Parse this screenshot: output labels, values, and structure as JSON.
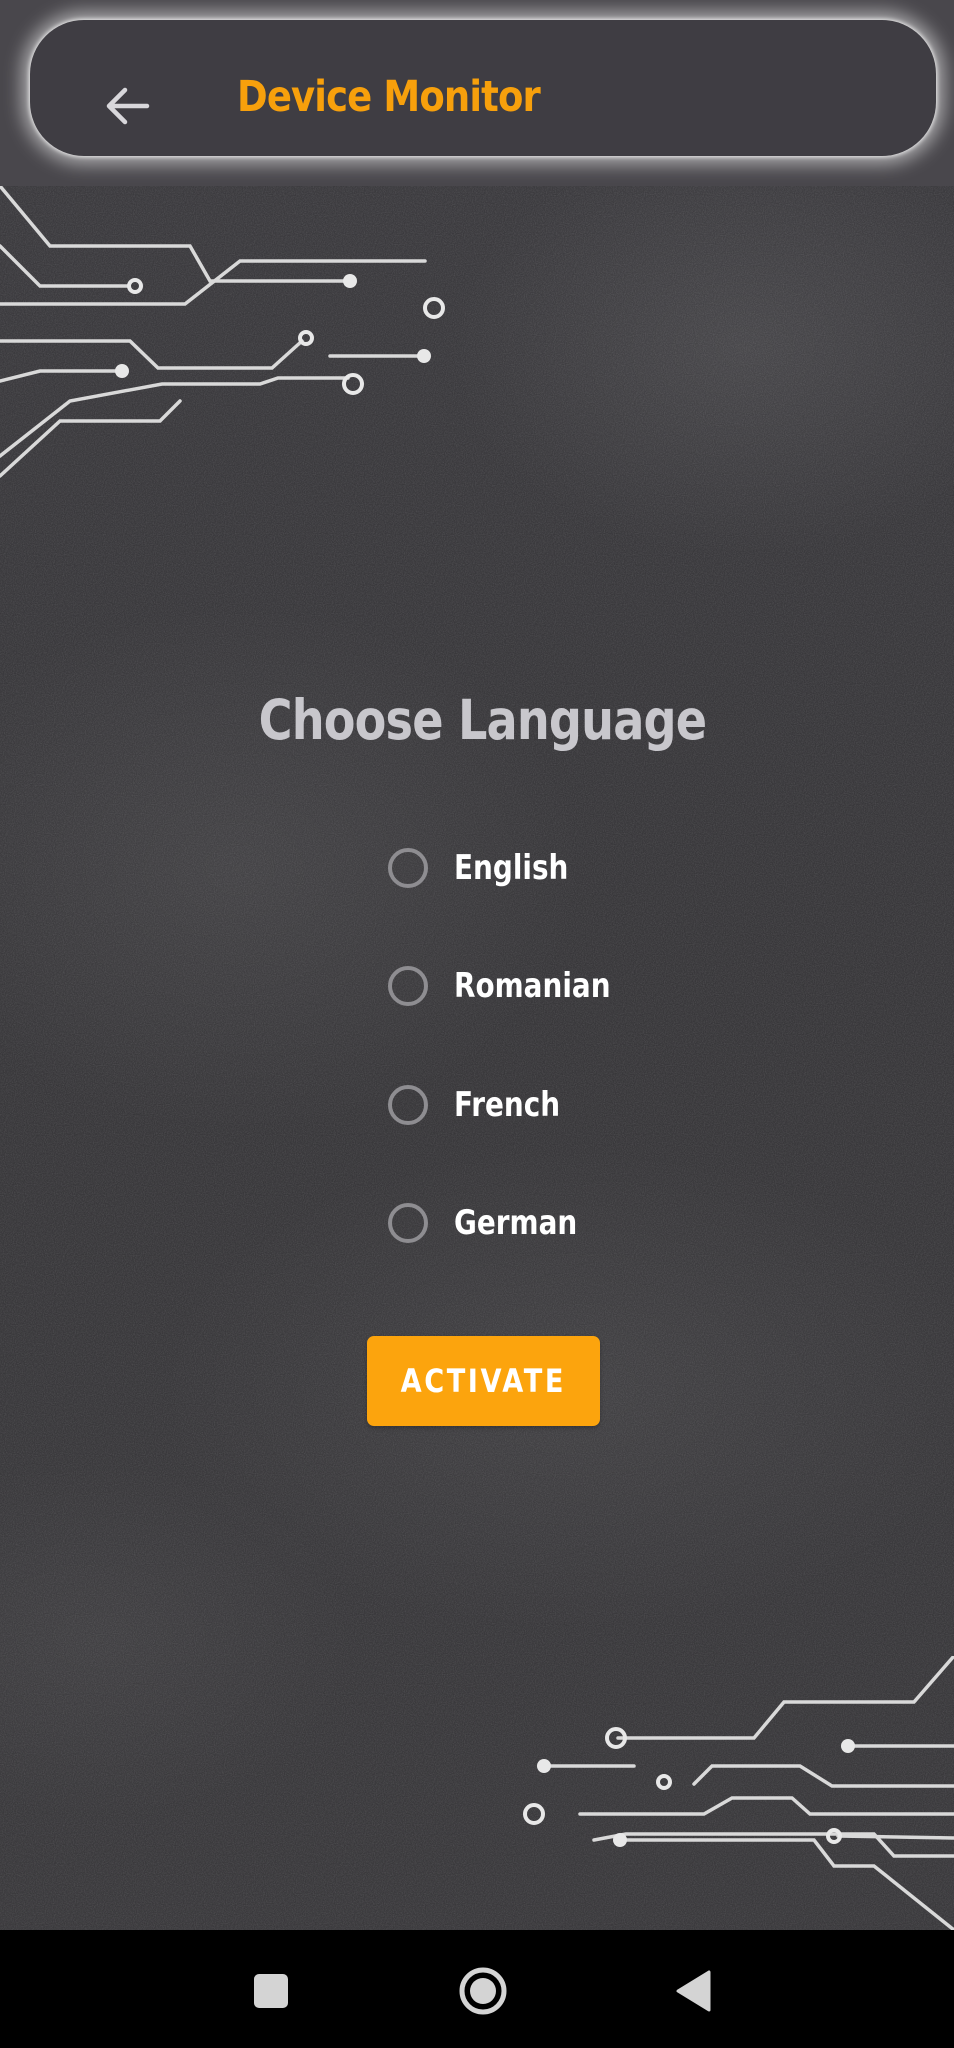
{
  "app": {
    "title": "Device Monitor",
    "accent_color": "#f7a00c",
    "button_color": "#fca40d",
    "background_color": "#3a393c"
  },
  "appbar": {
    "back_icon": "arrow-left-icon",
    "title": "Device Monitor"
  },
  "main": {
    "heading": "Choose Language",
    "languages": [
      {
        "label": "English",
        "selected": false
      },
      {
        "label": "Romanian",
        "selected": false
      },
      {
        "label": "French",
        "selected": false
      },
      {
        "label": "German",
        "selected": false
      }
    ],
    "activate_label": "ACTIVATE"
  },
  "navbar": {
    "recents_icon": "square-icon",
    "home_icon": "circle-home-icon",
    "back_icon": "triangle-back-icon"
  }
}
